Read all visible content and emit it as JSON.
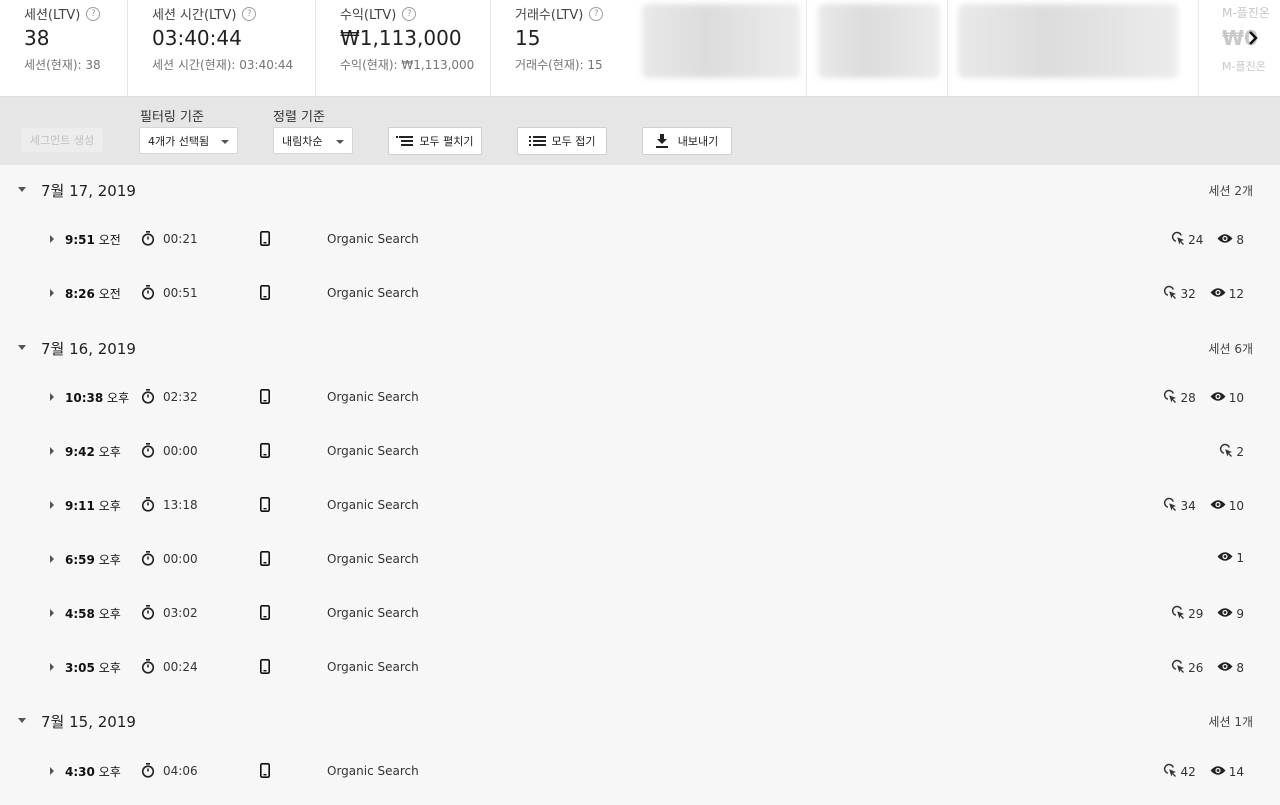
{
  "metrics": [
    {
      "label": "세션(LTV)",
      "value": "38",
      "sub": "세션(현재): 38"
    },
    {
      "label": "세션 시간(LTV)",
      "value": "03:40:44",
      "sub": "세션 시간(현재): 03:40:44"
    },
    {
      "label": "수익(LTV)",
      "value": "₩1,113,000",
      "sub": "수익(현재): ₩1,113,000"
    },
    {
      "label": "거래수(LTV)",
      "value": "15",
      "sub": "거래수(현재): 15"
    }
  ],
  "help_glyph": "?",
  "ghost_metric": {
    "label": "M-플진온",
    "value": "₩0",
    "sub": "M-플진온"
  },
  "toolbar": {
    "segment_button": "세그먼트 생성",
    "filter_label": "필터링 기준",
    "filter_value": "4개가 선택됨",
    "sort_label": "정렬 기준",
    "sort_value": "내림차순",
    "expand_all": "모두 펼치기",
    "collapse_all": "모두 접기",
    "export": "내보내기"
  },
  "groups": [
    {
      "date": "7월 17, 2019",
      "count": "세션 2개",
      "sessions": [
        {
          "time": "9:51",
          "ampm": "오전",
          "duration": "00:21",
          "channel": "Organic Search",
          "hits": "24",
          "views": "8"
        },
        {
          "time": "8:26",
          "ampm": "오전",
          "duration": "00:51",
          "channel": "Organic Search",
          "hits": "32",
          "views": "12"
        }
      ]
    },
    {
      "date": "7월 16, 2019",
      "count": "세션 6개",
      "sessions": [
        {
          "time": "10:38",
          "ampm": "오후",
          "duration": "02:32",
          "channel": "Organic Search",
          "hits": "28",
          "views": "10"
        },
        {
          "time": "9:42",
          "ampm": "오후",
          "duration": "00:00",
          "channel": "Organic Search",
          "hits": "2",
          "views": null
        },
        {
          "time": "9:11",
          "ampm": "오후",
          "duration": "13:18",
          "channel": "Organic Search",
          "hits": "34",
          "views": "10"
        },
        {
          "time": "6:59",
          "ampm": "오후",
          "duration": "00:00",
          "channel": "Organic Search",
          "hits": null,
          "views": "1"
        },
        {
          "time": "4:58",
          "ampm": "오후",
          "duration": "03:02",
          "channel": "Organic Search",
          "hits": "29",
          "views": "9"
        },
        {
          "time": "3:05",
          "ampm": "오후",
          "duration": "00:24",
          "channel": "Organic Search",
          "hits": "26",
          "views": "8"
        }
      ]
    },
    {
      "date": "7월 15, 2019",
      "count": "세션 1개",
      "sessions": [
        {
          "time": "4:30",
          "ampm": "오후",
          "duration": "04:06",
          "channel": "Organic Search",
          "hits": "42",
          "views": "14"
        }
      ]
    }
  ]
}
